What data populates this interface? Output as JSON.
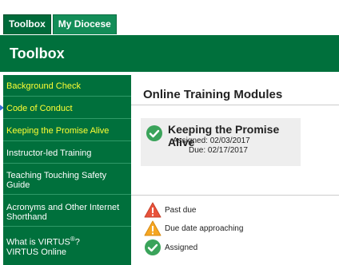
{
  "top_strip": {
    "text": "☆‾□□□□ ○○○○"
  },
  "tabs": [
    {
      "label": "Toolbox",
      "active": true
    },
    {
      "label": "My Diocese",
      "active": false
    }
  ],
  "banner": {
    "title": "Toolbox"
  },
  "sidebar": {
    "items": [
      {
        "label": "Background Check"
      },
      {
        "label": "Code of Conduct"
      },
      {
        "label": "Keeping the Promise Alive"
      },
      {
        "label": "Instructor-led Training"
      },
      {
        "label": "Teaching Touching Safety Guide"
      },
      {
        "label": "Acronyms and Other Internet Shorthand"
      },
      {
        "label_pre": "What is VIRTUS",
        "label_sup": "®",
        "label_post": "?",
        "label_line2": "VIRTUS Online"
      }
    ]
  },
  "content": {
    "title": "Online Training Modules",
    "module": {
      "title": "Keeping the Promise Alive",
      "assigned": "Assigned: 02/03/2017",
      "due": "Due: 02/17/2017"
    },
    "legend": [
      {
        "label": "Past due",
        "icon": "error-triangle-icon"
      },
      {
        "label": "Due date approaching",
        "icon": "warning-triangle-icon"
      },
      {
        "label": "Assigned",
        "icon": "check-circle-icon"
      }
    ]
  },
  "colors": {
    "brand_green": "#00703c",
    "link_yellow": "#ffff33",
    "past_due": "#e8533b",
    "approaching": "#f5a623",
    "assigned": "#3aa35a"
  }
}
